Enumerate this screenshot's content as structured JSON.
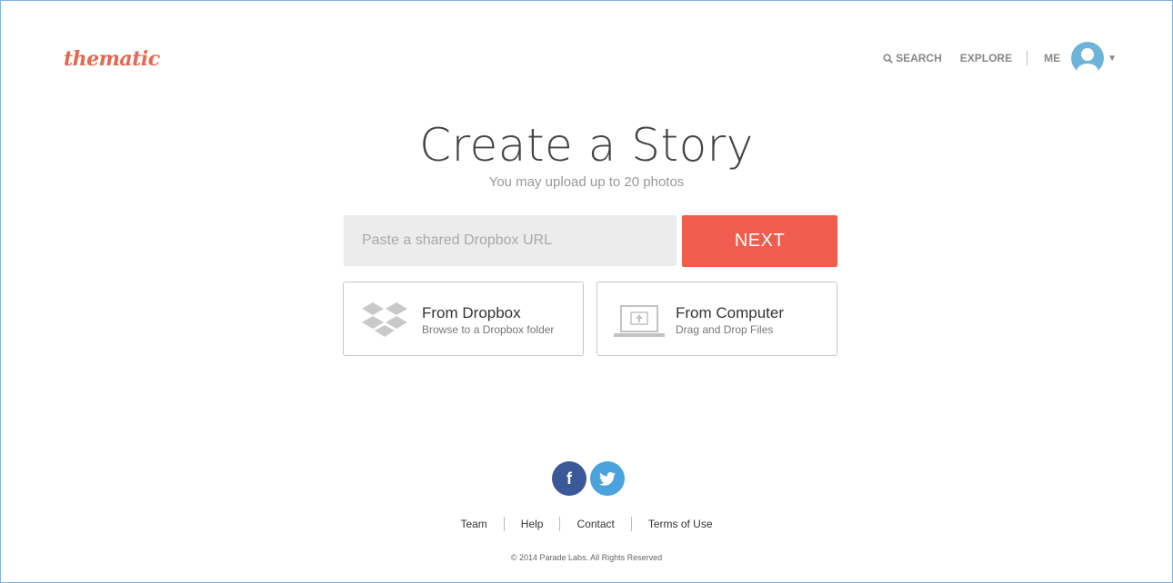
{
  "header": {
    "logo_text": "thematic",
    "nav": {
      "search_label": "SEARCH",
      "explore_label": "EXPLORE",
      "me_label": "ME"
    }
  },
  "main": {
    "title": "Create a Story",
    "subtitle": "You may upload up to 20 photos",
    "url_input": {
      "placeholder": "Paste a shared Dropbox URL",
      "value": ""
    },
    "next_label": "NEXT",
    "sources": [
      {
        "title": "From Dropbox",
        "subtitle": "Browse to a Dropbox folder",
        "icon": "dropbox-icon"
      },
      {
        "title": "From Computer",
        "subtitle": "Drag and Drop Files",
        "icon": "laptop-upload-icon"
      }
    ]
  },
  "footer": {
    "social": [
      {
        "name": "facebook",
        "icon": "facebook-icon",
        "color": "#3b5998"
      },
      {
        "name": "twitter",
        "icon": "twitter-icon",
        "color": "#4ba3de"
      }
    ],
    "links": [
      "Team",
      "Help",
      "Contact",
      "Terms of Use"
    ],
    "copyright": "© 2014 Parade Labs. All Rights Reserved"
  },
  "colors": {
    "brand": "#e8664f",
    "accent_button": "#f05d4c",
    "avatar": "#6fb3d9"
  }
}
